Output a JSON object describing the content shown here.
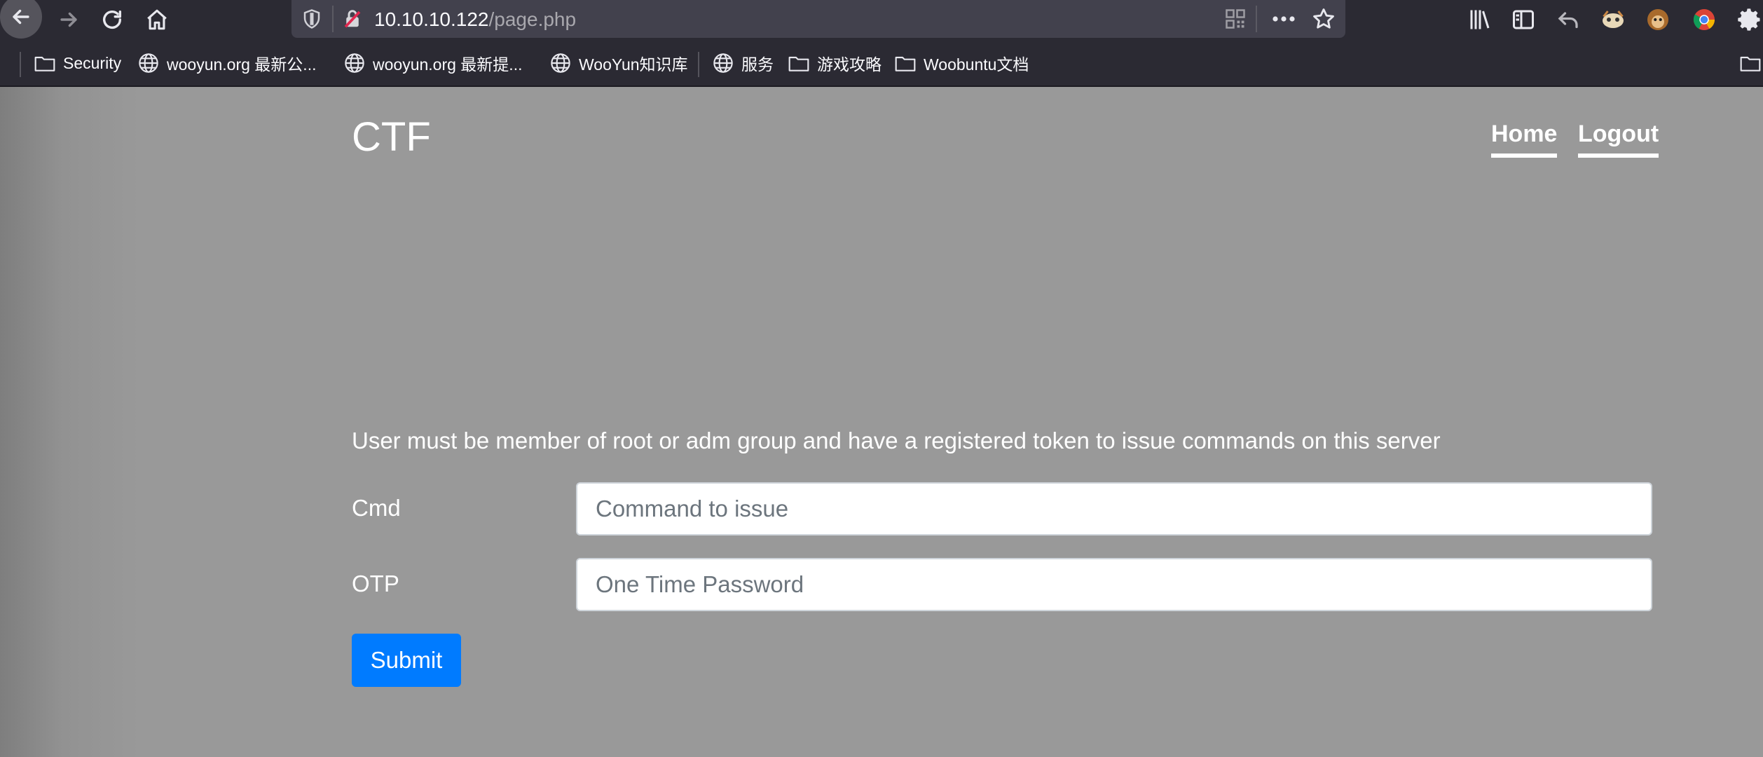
{
  "browser": {
    "url_host": "10.10.10.122",
    "url_path": "/page.php",
    "bookmarks": [
      {
        "label": "Security",
        "icon": "folder-icon"
      },
      {
        "label": "wooyun.org 最新公...",
        "icon": "globe-icon"
      },
      {
        "label": "wooyun.org 最新提...",
        "icon": "globe-icon"
      },
      {
        "label": "WooYun知识库",
        "icon": "globe-icon"
      },
      {
        "label": "服务",
        "icon": "globe-icon"
      },
      {
        "label": "游戏攻略",
        "icon": "folder-icon"
      },
      {
        "label": "Woobuntu文档",
        "icon": "folder-icon"
      }
    ]
  },
  "navbar": {
    "brand": "CTF",
    "links": [
      {
        "label": "Home"
      },
      {
        "label": "Logout"
      }
    ]
  },
  "main": {
    "notice": "User must be member of root or adm group and have a registered token to issue commands on this server",
    "form": {
      "cmd_label": "Cmd",
      "cmd_placeholder": "Command to issue",
      "otp_label": "OTP",
      "otp_placeholder": "One Time Password",
      "submit_label": "Submit"
    }
  },
  "colors": {
    "page_bg": "#999999",
    "primary": "#007bff",
    "toolbar_bg": "#2b2a33"
  }
}
